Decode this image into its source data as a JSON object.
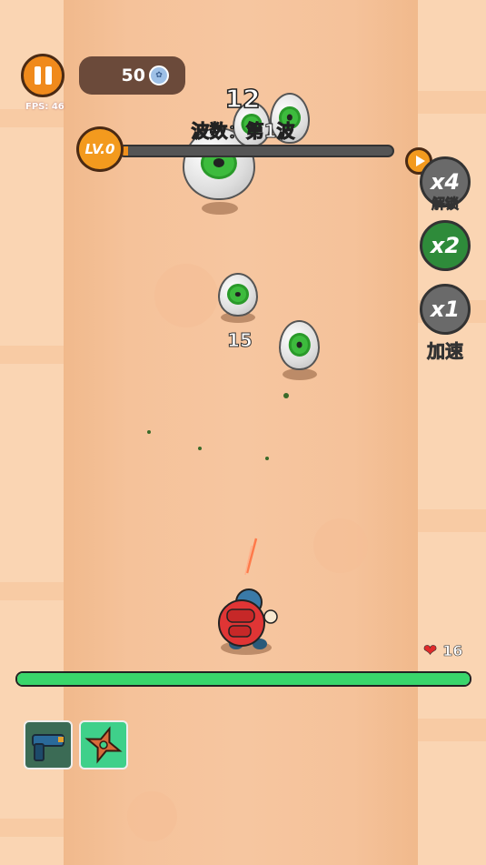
{
  "hud": {
    "fps_label": "FPS: 46",
    "coins": "50",
    "kill_count": "12",
    "wave_label": "波数：第1波",
    "level_label": "LV.0",
    "xp_progress": 0.03
  },
  "speed_controls": {
    "x4_label": "x4",
    "x4_sub": "解锁",
    "x2_label": "x2",
    "x1_label": "x1",
    "accelerate_label": "加速"
  },
  "combat": {
    "damage_number": "15"
  },
  "player": {
    "hp": "16",
    "hp_progress": 1.0
  },
  "weapons": [
    "pistol",
    "shuriken"
  ],
  "colors": {
    "accent_orange": "#f08a1c",
    "hp_green": "#39d66b",
    "enemy_green": "#3dbb3d",
    "x2_active": "#2e8b3a"
  }
}
